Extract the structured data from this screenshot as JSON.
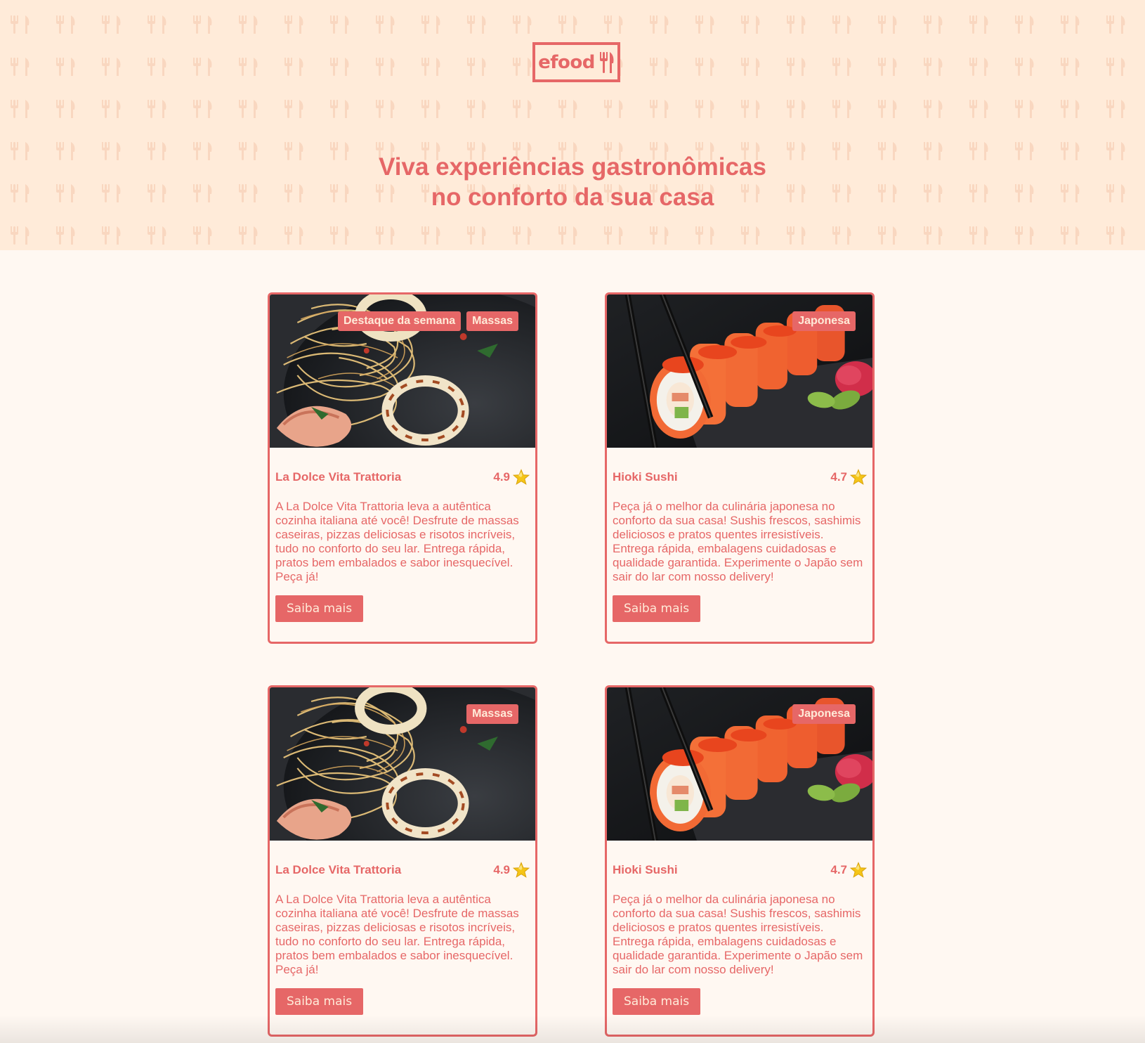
{
  "brand": {
    "logo_text": "efood"
  },
  "hero": {
    "title_line1": "Viva experiências gastronômicas",
    "title_line2": "no conforto da sua casa"
  },
  "colors": {
    "accent": "#E66767",
    "hero_bg": "#FFEBD9",
    "page_bg": "#FFF8F2",
    "star": "#F5C518"
  },
  "restaurants": [
    {
      "tags": [
        "Destaque da semana",
        "Massas"
      ],
      "name": "La Dolce Vita Trattoria",
      "rating": "4.9",
      "description": "A La Dolce Vita Trattoria leva a autêntica cozinha italiana até você! Desfrute de massas caseiras, pizzas deliciosas e risotos incríveis, tudo no conforto do seu lar. Entrega rápida, pratos bem embalados e sabor inesquecível. Peça já!",
      "button": "Saiba mais",
      "image": "pasta-photo"
    },
    {
      "tags": [
        "Japonesa"
      ],
      "name": "Hioki Sushi",
      "rating": "4.7",
      "description": "Peça já o melhor da culinária japonesa no conforto da sua casa! Sushis frescos, sashimis deliciosos e pratos quentes irresistíveis. Entrega rápida, embalagens cuidadosas e qualidade garantida. Experimente o Japão sem sair do lar com nosso delivery!",
      "button": "Saiba mais",
      "image": "sushi-photo"
    },
    {
      "tags": [
        "Massas"
      ],
      "name": "La Dolce Vita Trattoria",
      "rating": "4.9",
      "description": "A La Dolce Vita Trattoria leva a autêntica cozinha italiana até você! Desfrute de massas caseiras, pizzas deliciosas e risotos incríveis, tudo no conforto do seu lar. Entrega rápida, pratos bem embalados e sabor inesquecível. Peça já!",
      "button": "Saiba mais",
      "image": "pasta-photo"
    },
    {
      "tags": [
        "Japonesa"
      ],
      "name": "Hioki Sushi",
      "rating": "4.7",
      "description": "Peça já o melhor da culinária japonesa no conforto da sua casa! Sushis frescos, sashimis deliciosos e pratos quentes irresistíveis. Entrega rápida, embalagens cuidadosas e qualidade garantida. Experimente o Japão sem sair do lar com nosso delivery!",
      "button": "Saiba mais",
      "image": "sushi-photo"
    }
  ]
}
